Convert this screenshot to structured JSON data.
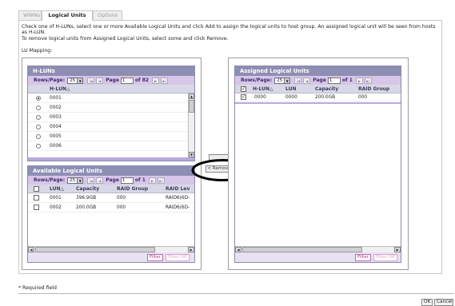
{
  "tabs": [
    {
      "label": "WWNs",
      "active": false
    },
    {
      "label": "Logical Units",
      "active": true
    },
    {
      "label": "Options",
      "active": false
    }
  ],
  "instructions": {
    "line1": "Check one of H-LUNs, select one or more Available Logical Units and click Add to assign the logical units to host group. An assigned logical unit will be seen from hosts as H-LUN.",
    "line2": "To remove logical units from Assigned Logical Units, select some and click Remove."
  },
  "lu_mapping_label": "LU Mapping:",
  "hluns": {
    "title": "H-LUNs",
    "pager": {
      "rows_label": "Rows/Page:",
      "rows_value": "25",
      "page_label": "Page",
      "page_value": "1",
      "of_label": "of 82",
      "first_icon": "first-page-icon",
      "prev_icon": "prev-page-icon",
      "next_icon": "next-page-icon",
      "last_icon": "last-page-icon"
    },
    "column": "H-LUN△",
    "rows": [
      {
        "value": "0001",
        "selected": true
      },
      {
        "value": "0002",
        "selected": false
      },
      {
        "value": "0003",
        "selected": false
      },
      {
        "value": "0004",
        "selected": false
      },
      {
        "value": "0005",
        "selected": false
      },
      {
        "value": "0006",
        "selected": false
      }
    ]
  },
  "available": {
    "title": "Available Logical Units",
    "pager": {
      "rows_label": "Rows/Page:",
      "rows_value": "25",
      "page_label": "Page",
      "page_value": "1",
      "of_label": "of 1"
    },
    "columns": [
      "LUN△",
      "Capacity",
      "RAID Group",
      "RAID Lev"
    ],
    "rows": [
      {
        "lun": "0001",
        "capacity": "396.9GB",
        "raid_group": "000",
        "raid_level": "RAID6(6D-"
      },
      {
        "lun": "0002",
        "capacity": "200.0GB",
        "raid_group": "000",
        "raid_level": "RAID6(6D-"
      }
    ],
    "filter_label": "Filter",
    "filter_off_label": "Filter Off"
  },
  "assigned": {
    "title": "Assigned Logical Units",
    "pager": {
      "rows_label": "Rows/Page:",
      "rows_value": "25",
      "page_label": "Page",
      "page_value": "1",
      "of_label": "of 1"
    },
    "columns": [
      "H-LUN△",
      "LUN",
      "Capacity",
      "RAID Group"
    ],
    "rows": [
      {
        "hlun": "0000",
        "lun": "0000",
        "capacity": "200.0GB",
        "raid_group": "000",
        "checked": true
      }
    ],
    "header_checked": true,
    "filter_label": "Filter",
    "filter_off_label": "Filter Off"
  },
  "actions": {
    "add_label": "",
    "remove_label": "< Remove"
  },
  "required_note": "* Required field",
  "footer": {
    "ok_label": "OK",
    "cancel_label": "Cancel"
  },
  "colors": {
    "panel_title": "#8e8eb4",
    "pager_bg": "#d7c6e8",
    "filter_accent": "#b0308e",
    "annotation": "#000000"
  }
}
